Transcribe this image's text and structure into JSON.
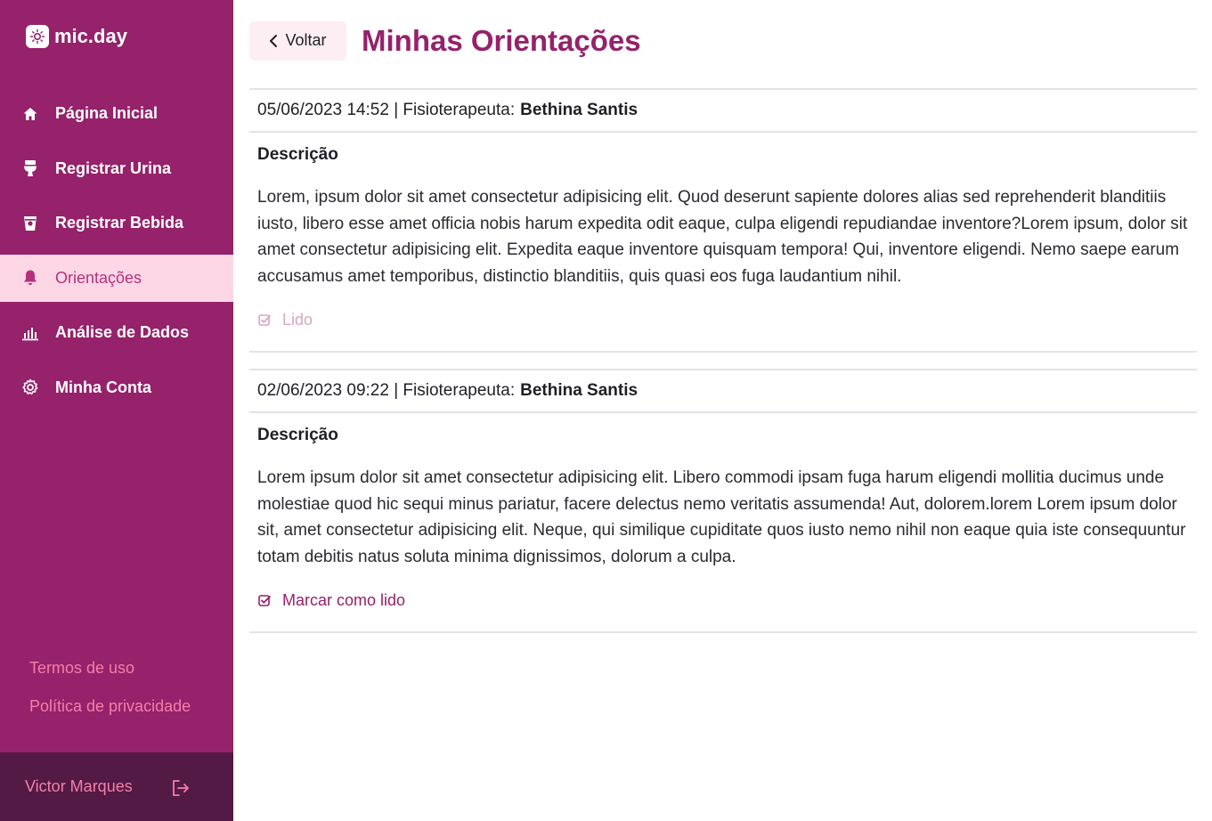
{
  "app": {
    "name": "mic.day"
  },
  "sidebar": {
    "items": [
      {
        "label": "Página Inicial",
        "icon": "home-icon"
      },
      {
        "label": "Registrar Urina",
        "icon": "toilet-icon"
      },
      {
        "label": "Registrar Bebida",
        "icon": "cup-icon"
      },
      {
        "label": "Orientações",
        "icon": "bell-icon",
        "active": true
      },
      {
        "label": "Análise de Dados",
        "icon": "bar-chart-icon"
      },
      {
        "label": "Minha Conta",
        "icon": "gear-icon"
      }
    ],
    "footer": {
      "terms": "Termos de uso",
      "privacy": "Política de privacidade"
    },
    "user": {
      "name": "Victor Marques",
      "logout_icon": "logout-icon"
    }
  },
  "header": {
    "back_label": "Voltar",
    "title": "Minhas Orientações"
  },
  "orientations": [
    {
      "datetime": "05/06/2023 14:52",
      "role_label": "| Fisioterapeuta:",
      "author": "Bethina Santis",
      "desc_title": "Descrição",
      "text": "Lorem, ipsum dolor sit amet consectetur adipisicing elit. Quod deserunt sapiente dolores alias sed reprehenderit blanditiis iusto, libero esse amet officia nobis harum expedita odit eaque, culpa eligendi repudiandae inventore?Lorem ipsum, dolor sit amet consectetur adipisicing elit. Expedita eaque inventore quisquam tempora! Qui, inventore eligendi. Nemo saepe earum accusamus amet temporibus, distinctio blanditiis, quis quasi eos fuga laudantium nihil.",
      "action_label": "Lido",
      "read": true
    },
    {
      "datetime": "02/06/2023 09:22",
      "role_label": "| Fisioterapeuta:",
      "author": "Bethina Santis",
      "desc_title": "Descrição",
      "text": "Lorem ipsum dolor sit amet consectetur adipisicing elit. Libero commodi ipsam fuga harum eligendi mollitia ducimus unde molestiae quod hic sequi minus pariatur, facere delectus nemo veritatis assumenda! Aut, dolorem.lorem Lorem ipsum dolor sit, amet consectetur adipisicing elit. Neque, qui similique cupiditate quos iusto nemo nihil non eaque quia iste consequuntur totam debitis natus soluta minima dignissimos, dolorum a culpa.",
      "action_label": "Marcar como lido",
      "read": false
    }
  ],
  "colors": {
    "sidebar": "#95226a",
    "sidebar_active_bg": "#fdd7e6",
    "accent": "#95226a",
    "link_pink": "#f47fab",
    "user_bar": "#531a45"
  }
}
